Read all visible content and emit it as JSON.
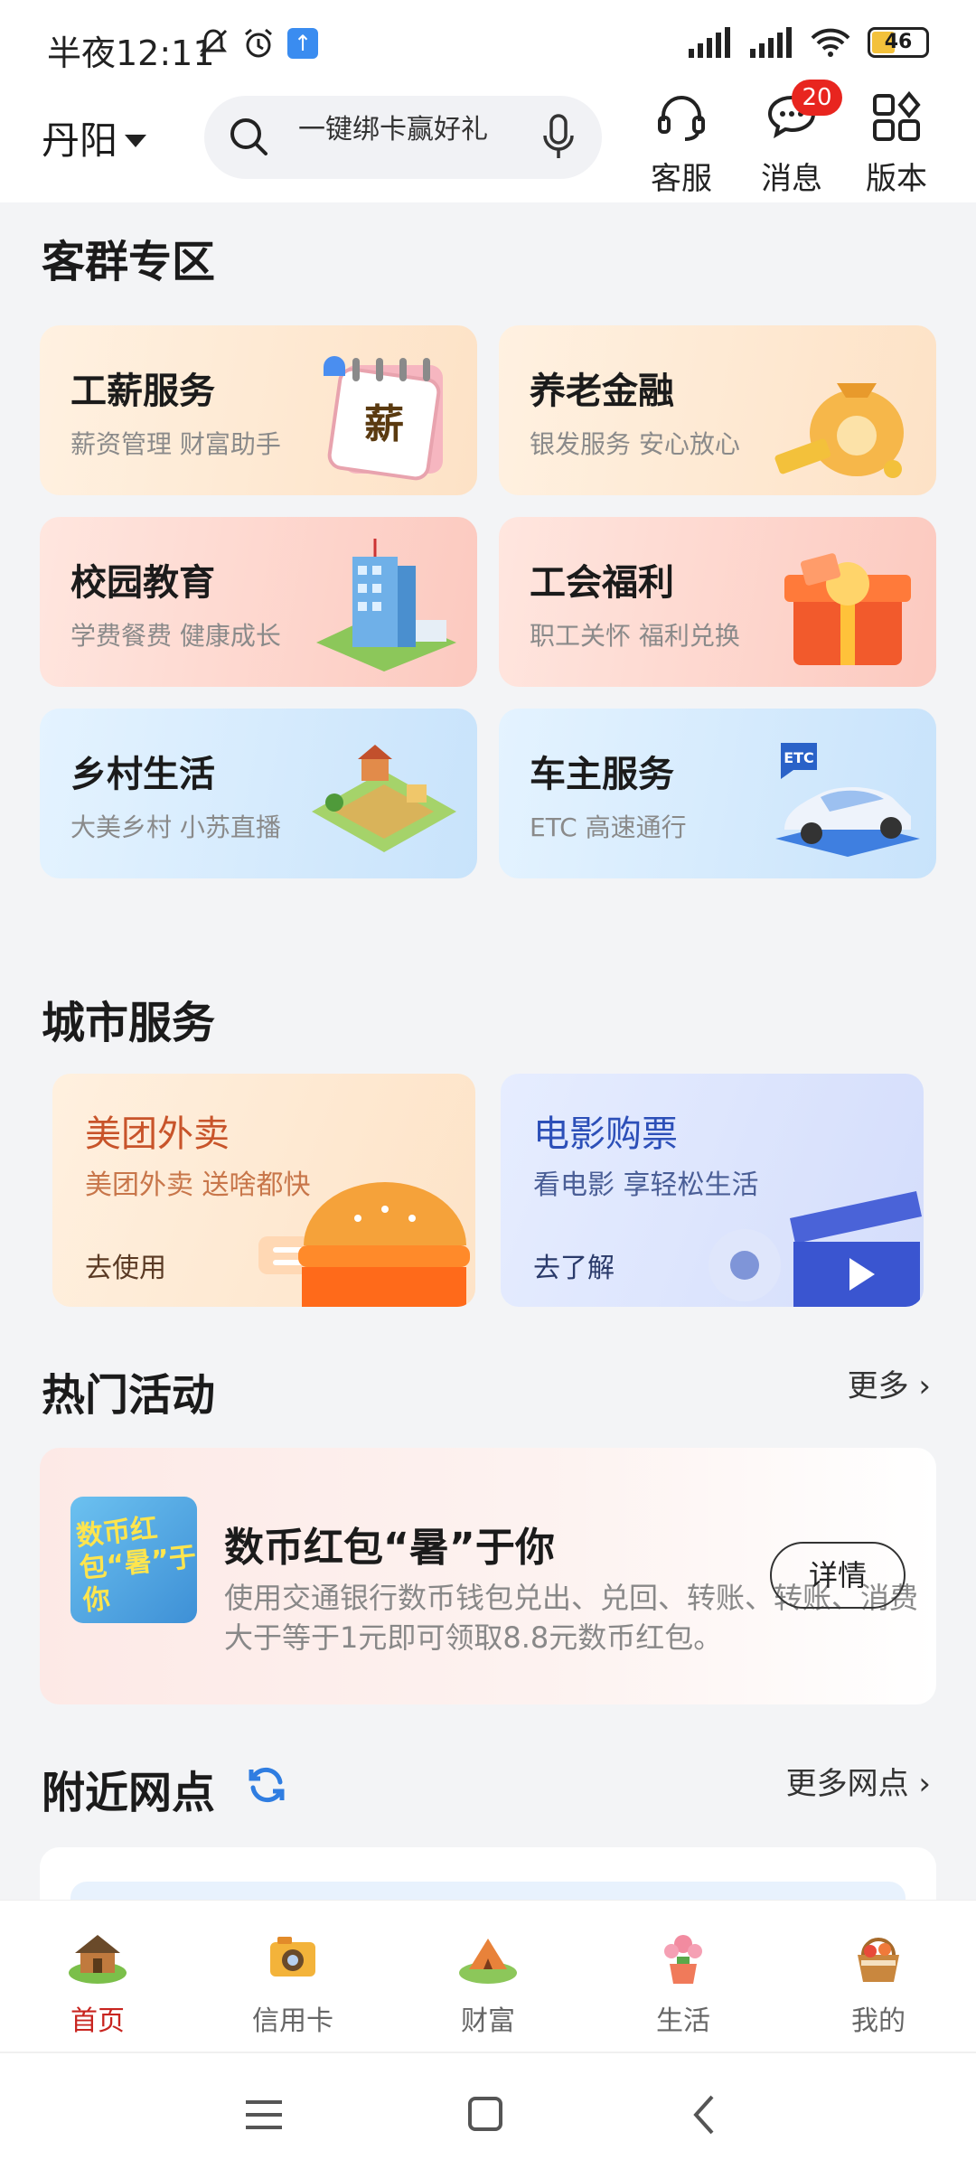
{
  "status_bar": {
    "time": "半夜12:11",
    "battery": "46"
  },
  "header": {
    "city": "丹阳",
    "search_placeholder": "一键绑卡赢好礼",
    "service_label": "客服",
    "message_label": "消息",
    "message_badge": "20",
    "version_label": "版本"
  },
  "customer_zone": {
    "title": "客群专区",
    "cards": [
      {
        "title": "工薪服务",
        "subtitle": "薪资管理 财富助手",
        "icon": "calendar-salary-icon",
        "badge_text": "薪"
      },
      {
        "title": "养老金融",
        "subtitle": "银发服务 安心放心",
        "icon": "money-bag-icon"
      },
      {
        "title": "校园教育",
        "subtitle": "学费餐费 健康成长",
        "icon": "school-building-icon"
      },
      {
        "title": "工会福利",
        "subtitle": "职工关怀 福利兑换",
        "icon": "gift-box-icon"
      },
      {
        "title": "乡村生活",
        "subtitle": "大美乡村 小苏直播",
        "icon": "village-icon"
      },
      {
        "title": "车主服务",
        "subtitle": "ETC 高速通行",
        "icon": "car-etc-icon",
        "tag_text": "ETC"
      }
    ]
  },
  "city_services": {
    "title": "城市服务",
    "cards": [
      {
        "title": "美团外卖",
        "subtitle": "美团外卖 送啥都快",
        "action": "去使用",
        "icon": "burger-icon",
        "accent": "#c8542a"
      },
      {
        "title": "电影购票",
        "subtitle": "看电影 享轻松生活",
        "action": "去了解",
        "icon": "clapperboard-icon",
        "accent": "#2c4fb8"
      }
    ]
  },
  "hot_activities": {
    "title": "热门活动",
    "more": "更多",
    "item": {
      "thumb_text": "数币红包“暑”于你",
      "title": "数币红包“暑”于你",
      "description": "使用交通银行数币钱包兑出、兑回、转账、转账、消费大于等于1元即可领取8.8元数币红包。",
      "button": "详情"
    }
  },
  "nearby": {
    "title": "附近网点",
    "more": "更多网点"
  },
  "bottom_nav": {
    "items": [
      {
        "label": "首页",
        "icon": "home-icon",
        "active": true
      },
      {
        "label": "信用卡",
        "icon": "credit-card-icon",
        "active": false
      },
      {
        "label": "财富",
        "icon": "wealth-icon",
        "active": false
      },
      {
        "label": "生活",
        "icon": "life-icon",
        "active": false
      },
      {
        "label": "我的",
        "icon": "mine-icon",
        "active": false
      }
    ]
  },
  "colors": {
    "accent_red": "#c8241f",
    "badge_red": "#e8251f",
    "refresh_blue": "#2f7de1"
  }
}
